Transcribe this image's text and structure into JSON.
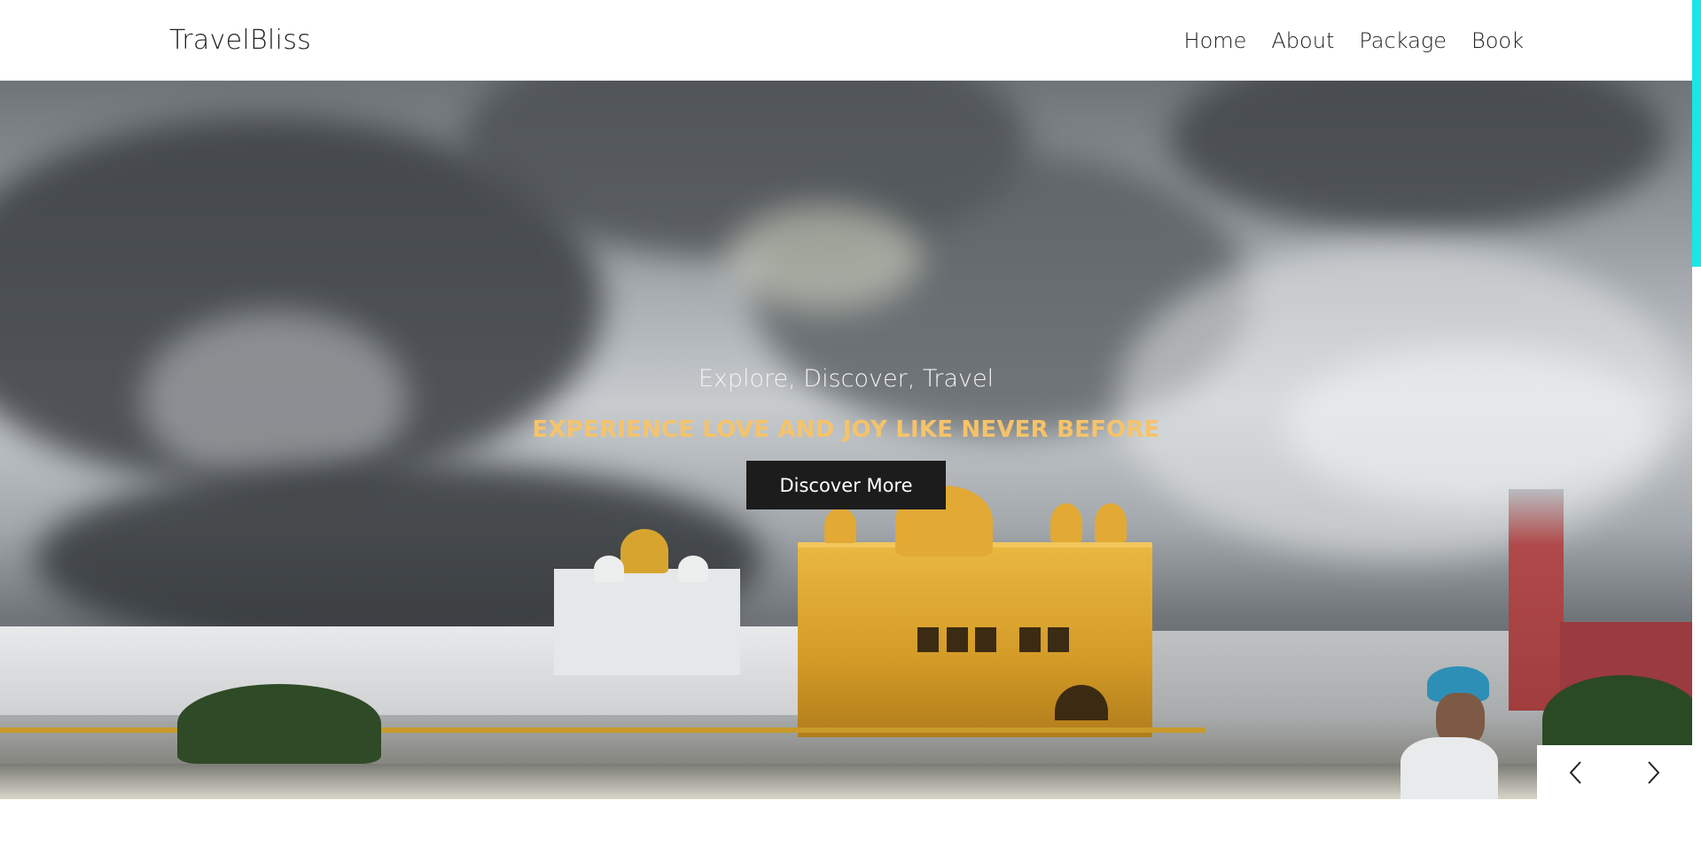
{
  "header": {
    "brand": "TravelBliss",
    "nav": [
      {
        "label": "Home"
      },
      {
        "label": "About"
      },
      {
        "label": "Package"
      },
      {
        "label": "Book"
      }
    ]
  },
  "hero": {
    "subtitle": "Explore, Discover, Travel",
    "title": "EXPERIENCE LOVE AND JOY LIKE NEVER BEFORE",
    "cta_label": "Discover More",
    "image_subject": "Golden Temple under cloudy sky"
  },
  "slider": {
    "prev_icon": "chevron-left-icon",
    "next_icon": "chevron-right-icon"
  },
  "colors": {
    "accent_title": "#f5c36a",
    "cta_bg": "#1c1c1c",
    "scrollbar_thumb": "#19e6e6"
  }
}
